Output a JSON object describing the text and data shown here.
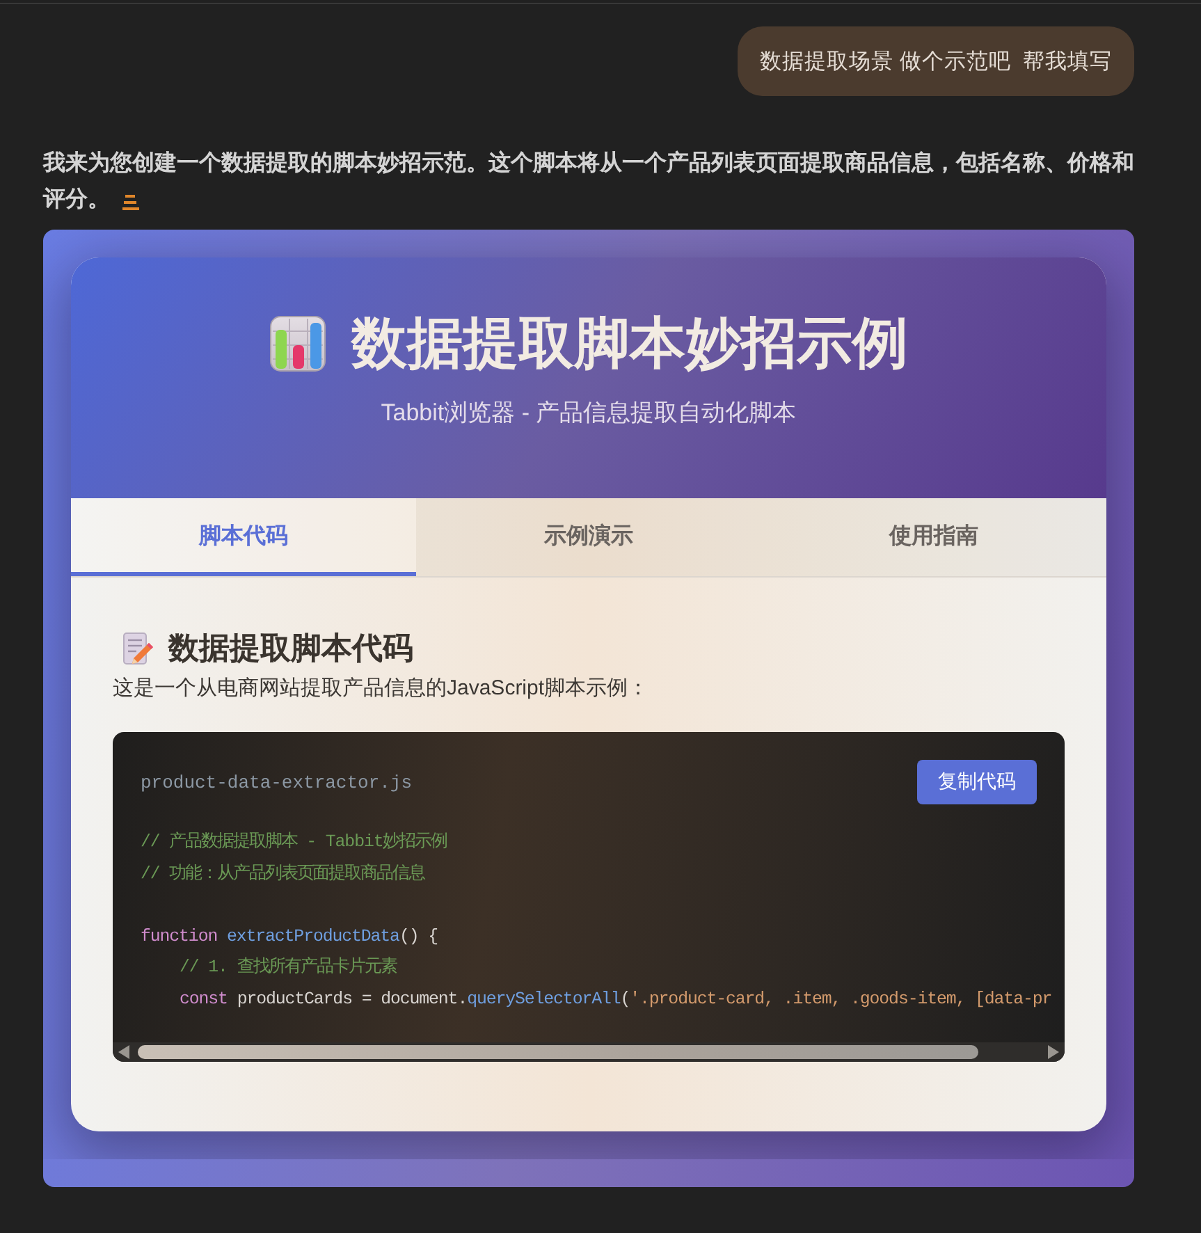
{
  "chat": {
    "user_message": "数据提取场景 做个示范吧  帮我填写",
    "assistant_message_lines": [
      "我来为您创建一个数据提取的脚本妙招示范。这个脚本将从一个产品列表页面提取商品信息，包括名称、价格和",
      "评分。"
    ]
  },
  "preview": {
    "title": "数据提取脚本妙招示例",
    "subtitle": "Tabbit浏览器 - 产品信息提取自动化脚本",
    "tabs": [
      {
        "label": "脚本代码",
        "selected": true
      },
      {
        "label": "示例演示",
        "selected": false
      },
      {
        "label": "使用指南",
        "selected": false
      }
    ],
    "section": {
      "heading": "数据提取脚本代码",
      "description": "这是一个从电商网站提取产品信息的JavaScript脚本示例："
    },
    "code_block": {
      "filename": "product-data-extractor.js",
      "copy_button": "复制代码",
      "lines": [
        {
          "kind": "code",
          "indented": false,
          "tokens": [
            {
              "kind": "comment",
              "text": "// 产品数据提取脚本 - Tabbit妙招示例"
            }
          ]
        },
        {
          "kind": "code",
          "indented": false,
          "tokens": [
            {
              "kind": "comment",
              "text": "// 功能：从产品列表页面提取商品信息"
            }
          ]
        },
        {
          "kind": "blank"
        },
        {
          "kind": "code",
          "indented": false,
          "tokens": [
            {
              "kind": "keyword",
              "text": "function "
            },
            {
              "kind": "function",
              "text": "extractProductData"
            },
            {
              "kind": "plain",
              "text": "() {"
            }
          ]
        },
        {
          "kind": "code",
          "indented": true,
          "tokens": [
            {
              "kind": "comment",
              "text": "// 1. 查找所有产品卡片元素"
            }
          ]
        },
        {
          "kind": "code",
          "indented": true,
          "tokens": [
            {
              "kind": "keyword",
              "text": "const"
            },
            {
              "kind": "plain",
              "text": " productCards = document."
            },
            {
              "kind": "method",
              "text": "querySelectorAll"
            },
            {
              "kind": "plain",
              "text": "("
            },
            {
              "kind": "string",
              "text": "'.product-card, .item, .goods-item, [data-pr"
            }
          ]
        }
      ]
    }
  }
}
